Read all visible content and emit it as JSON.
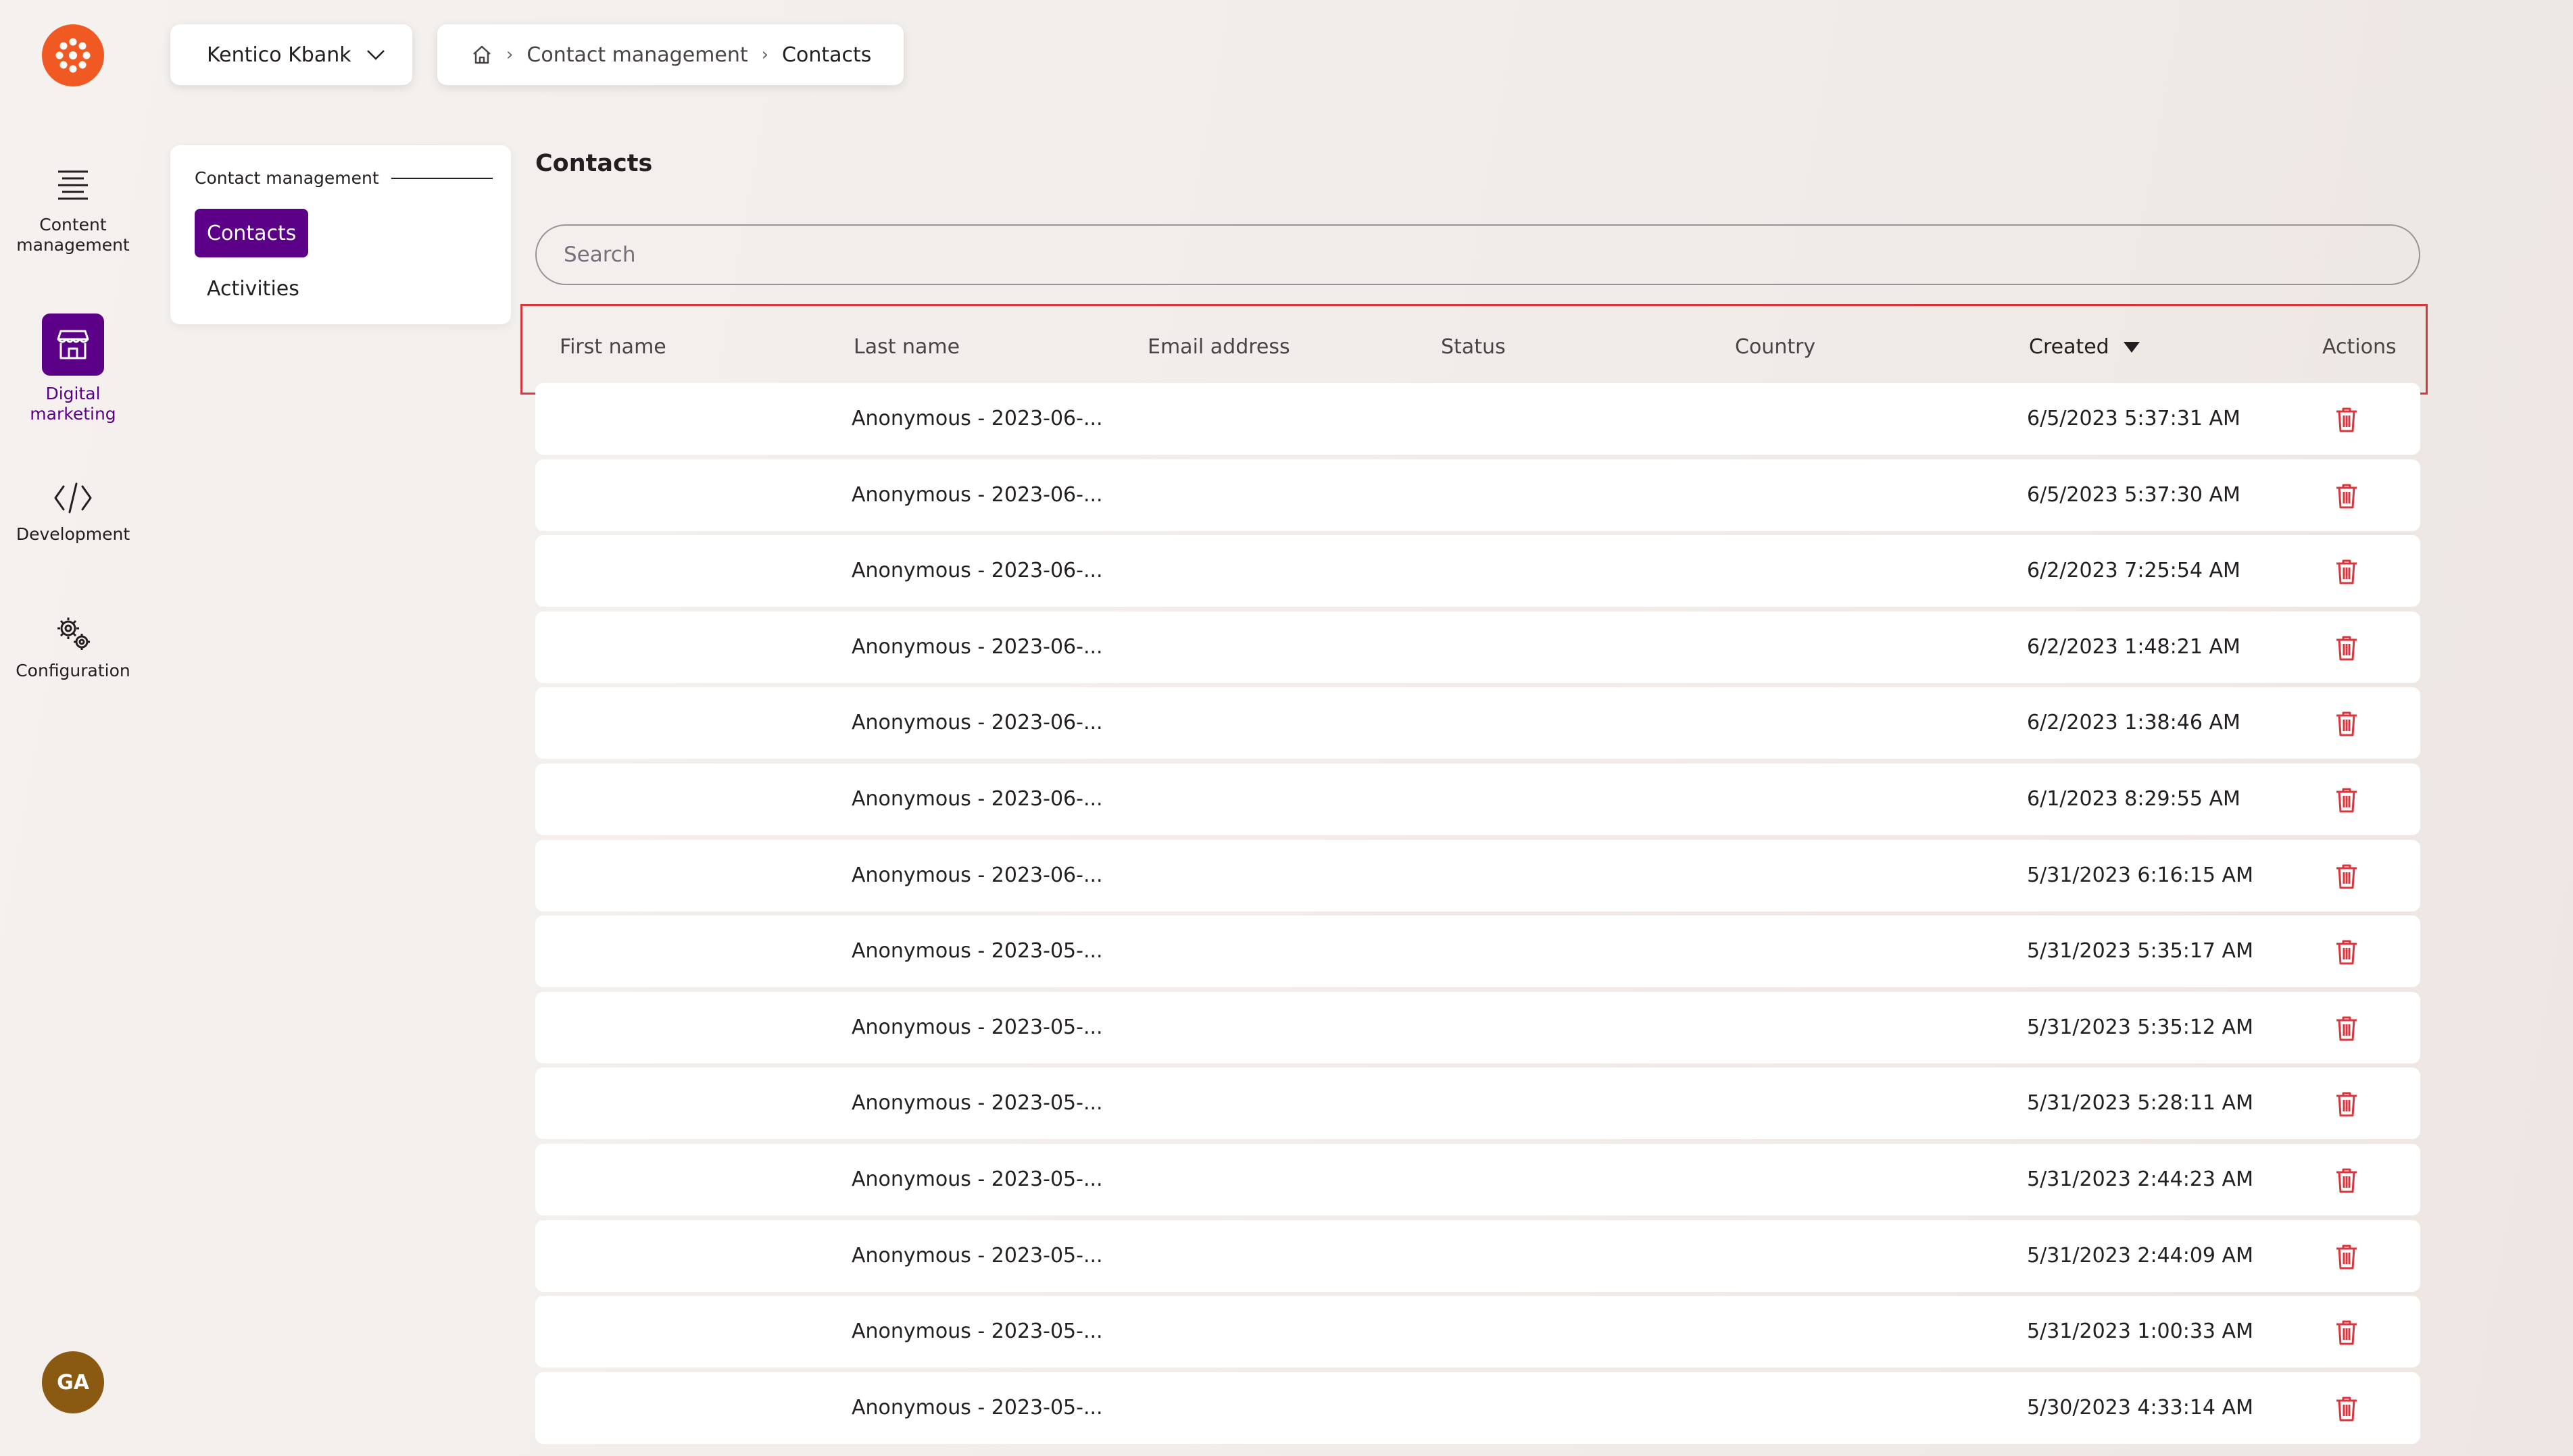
{
  "rail": {
    "items": [
      {
        "label_line1": "Content",
        "label_line2": "management",
        "icon": "content-icon"
      },
      {
        "label_line1": "Digital",
        "label_line2": "marketing",
        "icon": "store-icon"
      },
      {
        "label_line1": "Development",
        "label_line2": "",
        "icon": "code-icon"
      },
      {
        "label_line1": "Configuration",
        "label_line2": "",
        "icon": "gears-icon"
      }
    ],
    "avatar_initials": "GA"
  },
  "header": {
    "site_name": "Kentico Kbank",
    "breadcrumb": [
      "Contact management",
      "Contacts"
    ]
  },
  "menu": {
    "heading": "Contact management",
    "items": [
      "Contacts",
      "Activities"
    ]
  },
  "main": {
    "title": "Contacts",
    "search_placeholder": "Search",
    "columns": [
      "First name",
      "Last name",
      "Email address",
      "Status",
      "Country",
      "Created",
      "Actions"
    ],
    "sort_column": "Created",
    "rows": [
      {
        "first_name": "",
        "last_name": "Anonymous - 2023-06-...",
        "email": "",
        "status": "",
        "country": "",
        "created": "6/5/2023 5:37:31 AM"
      },
      {
        "first_name": "",
        "last_name": "Anonymous - 2023-06-...",
        "email": "",
        "status": "",
        "country": "",
        "created": "6/5/2023 5:37:30 AM"
      },
      {
        "first_name": "",
        "last_name": "Anonymous - 2023-06-...",
        "email": "",
        "status": "",
        "country": "",
        "created": "6/2/2023 7:25:54 AM"
      },
      {
        "first_name": "",
        "last_name": "Anonymous - 2023-06-...",
        "email": "",
        "status": "",
        "country": "",
        "created": "6/2/2023 1:48:21 AM"
      },
      {
        "first_name": "",
        "last_name": "Anonymous - 2023-06-...",
        "email": "",
        "status": "",
        "country": "",
        "created": "6/2/2023 1:38:46 AM"
      },
      {
        "first_name": "",
        "last_name": "Anonymous - 2023-06-...",
        "email": "",
        "status": "",
        "country": "",
        "created": "6/1/2023 8:29:55 AM"
      },
      {
        "first_name": "",
        "last_name": "Anonymous - 2023-06-...",
        "email": "",
        "status": "",
        "country": "",
        "created": "5/31/2023 6:16:15 AM"
      },
      {
        "first_name": "",
        "last_name": "Anonymous - 2023-05-...",
        "email": "",
        "status": "",
        "country": "",
        "created": "5/31/2023 5:35:17 AM"
      },
      {
        "first_name": "",
        "last_name": "Anonymous - 2023-05-...",
        "email": "",
        "status": "",
        "country": "",
        "created": "5/31/2023 5:35:12 AM"
      },
      {
        "first_name": "",
        "last_name": "Anonymous - 2023-05-...",
        "email": "",
        "status": "",
        "country": "",
        "created": "5/31/2023 5:28:11 AM"
      },
      {
        "first_name": "",
        "last_name": "Anonymous - 2023-05-...",
        "email": "",
        "status": "",
        "country": "",
        "created": "5/31/2023 2:44:23 AM"
      },
      {
        "first_name": "",
        "last_name": "Anonymous - 2023-05-...",
        "email": "",
        "status": "",
        "country": "",
        "created": "5/31/2023 2:44:09 AM"
      },
      {
        "first_name": "",
        "last_name": "Anonymous - 2023-05-...",
        "email": "",
        "status": "",
        "country": "",
        "created": "5/31/2023 1:00:33 AM"
      },
      {
        "first_name": "",
        "last_name": "Anonymous - 2023-05-...",
        "email": "",
        "status": "",
        "country": "",
        "created": "5/30/2023 4:33:14 AM"
      }
    ]
  },
  "colors": {
    "brand_orange": "#f05a22",
    "accent_purple": "#5b0087",
    "delete_red": "#d9363e",
    "highlight_border": "#d9363e",
    "avatar_brown": "#8a5a12"
  }
}
